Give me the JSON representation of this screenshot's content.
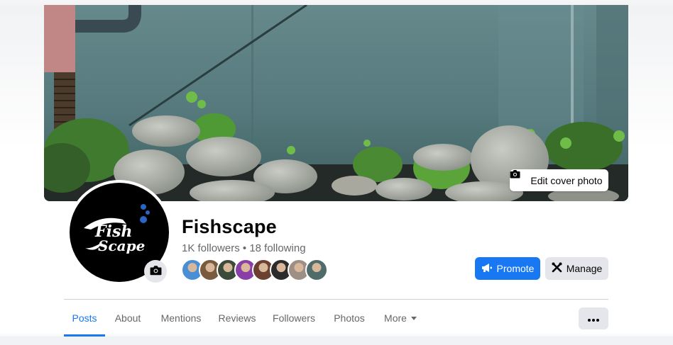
{
  "cover": {
    "edit_label": "Edit cover photo",
    "edit_icon": "camera-icon"
  },
  "profile": {
    "name": "Fishscape",
    "logo_text_top": "Fish",
    "logo_text_bottom": "Scape",
    "followers": "1K followers",
    "separator": "•",
    "following": "18 following",
    "camera_icon": "camera-icon",
    "friend_avatar_colors": [
      "#4a8fd6",
      "#7a5b3e",
      "#3c4a3a",
      "#8a3fa6",
      "#6b4030",
      "#2c2c2c",
      "#9e8f86",
      "#4f6b6a"
    ]
  },
  "actions": {
    "promote_label": "Promote",
    "promote_icon": "megaphone-icon",
    "manage_label": "Manage",
    "manage_icon": "tools-icon"
  },
  "tabs": [
    {
      "label": "Posts",
      "active": true
    },
    {
      "label": "About",
      "active": false
    },
    {
      "label": "Mentions",
      "active": false
    },
    {
      "label": "Reviews",
      "active": false
    },
    {
      "label": "Followers",
      "active": false
    },
    {
      "label": "Photos",
      "active": false
    },
    {
      "label": "More",
      "active": false
    }
  ],
  "more_menu_icon": "ellipsis-icon",
  "colors": {
    "accent": "#1877f2",
    "secondary_button": "#e4e6eb",
    "muted_text": "#65676b"
  }
}
